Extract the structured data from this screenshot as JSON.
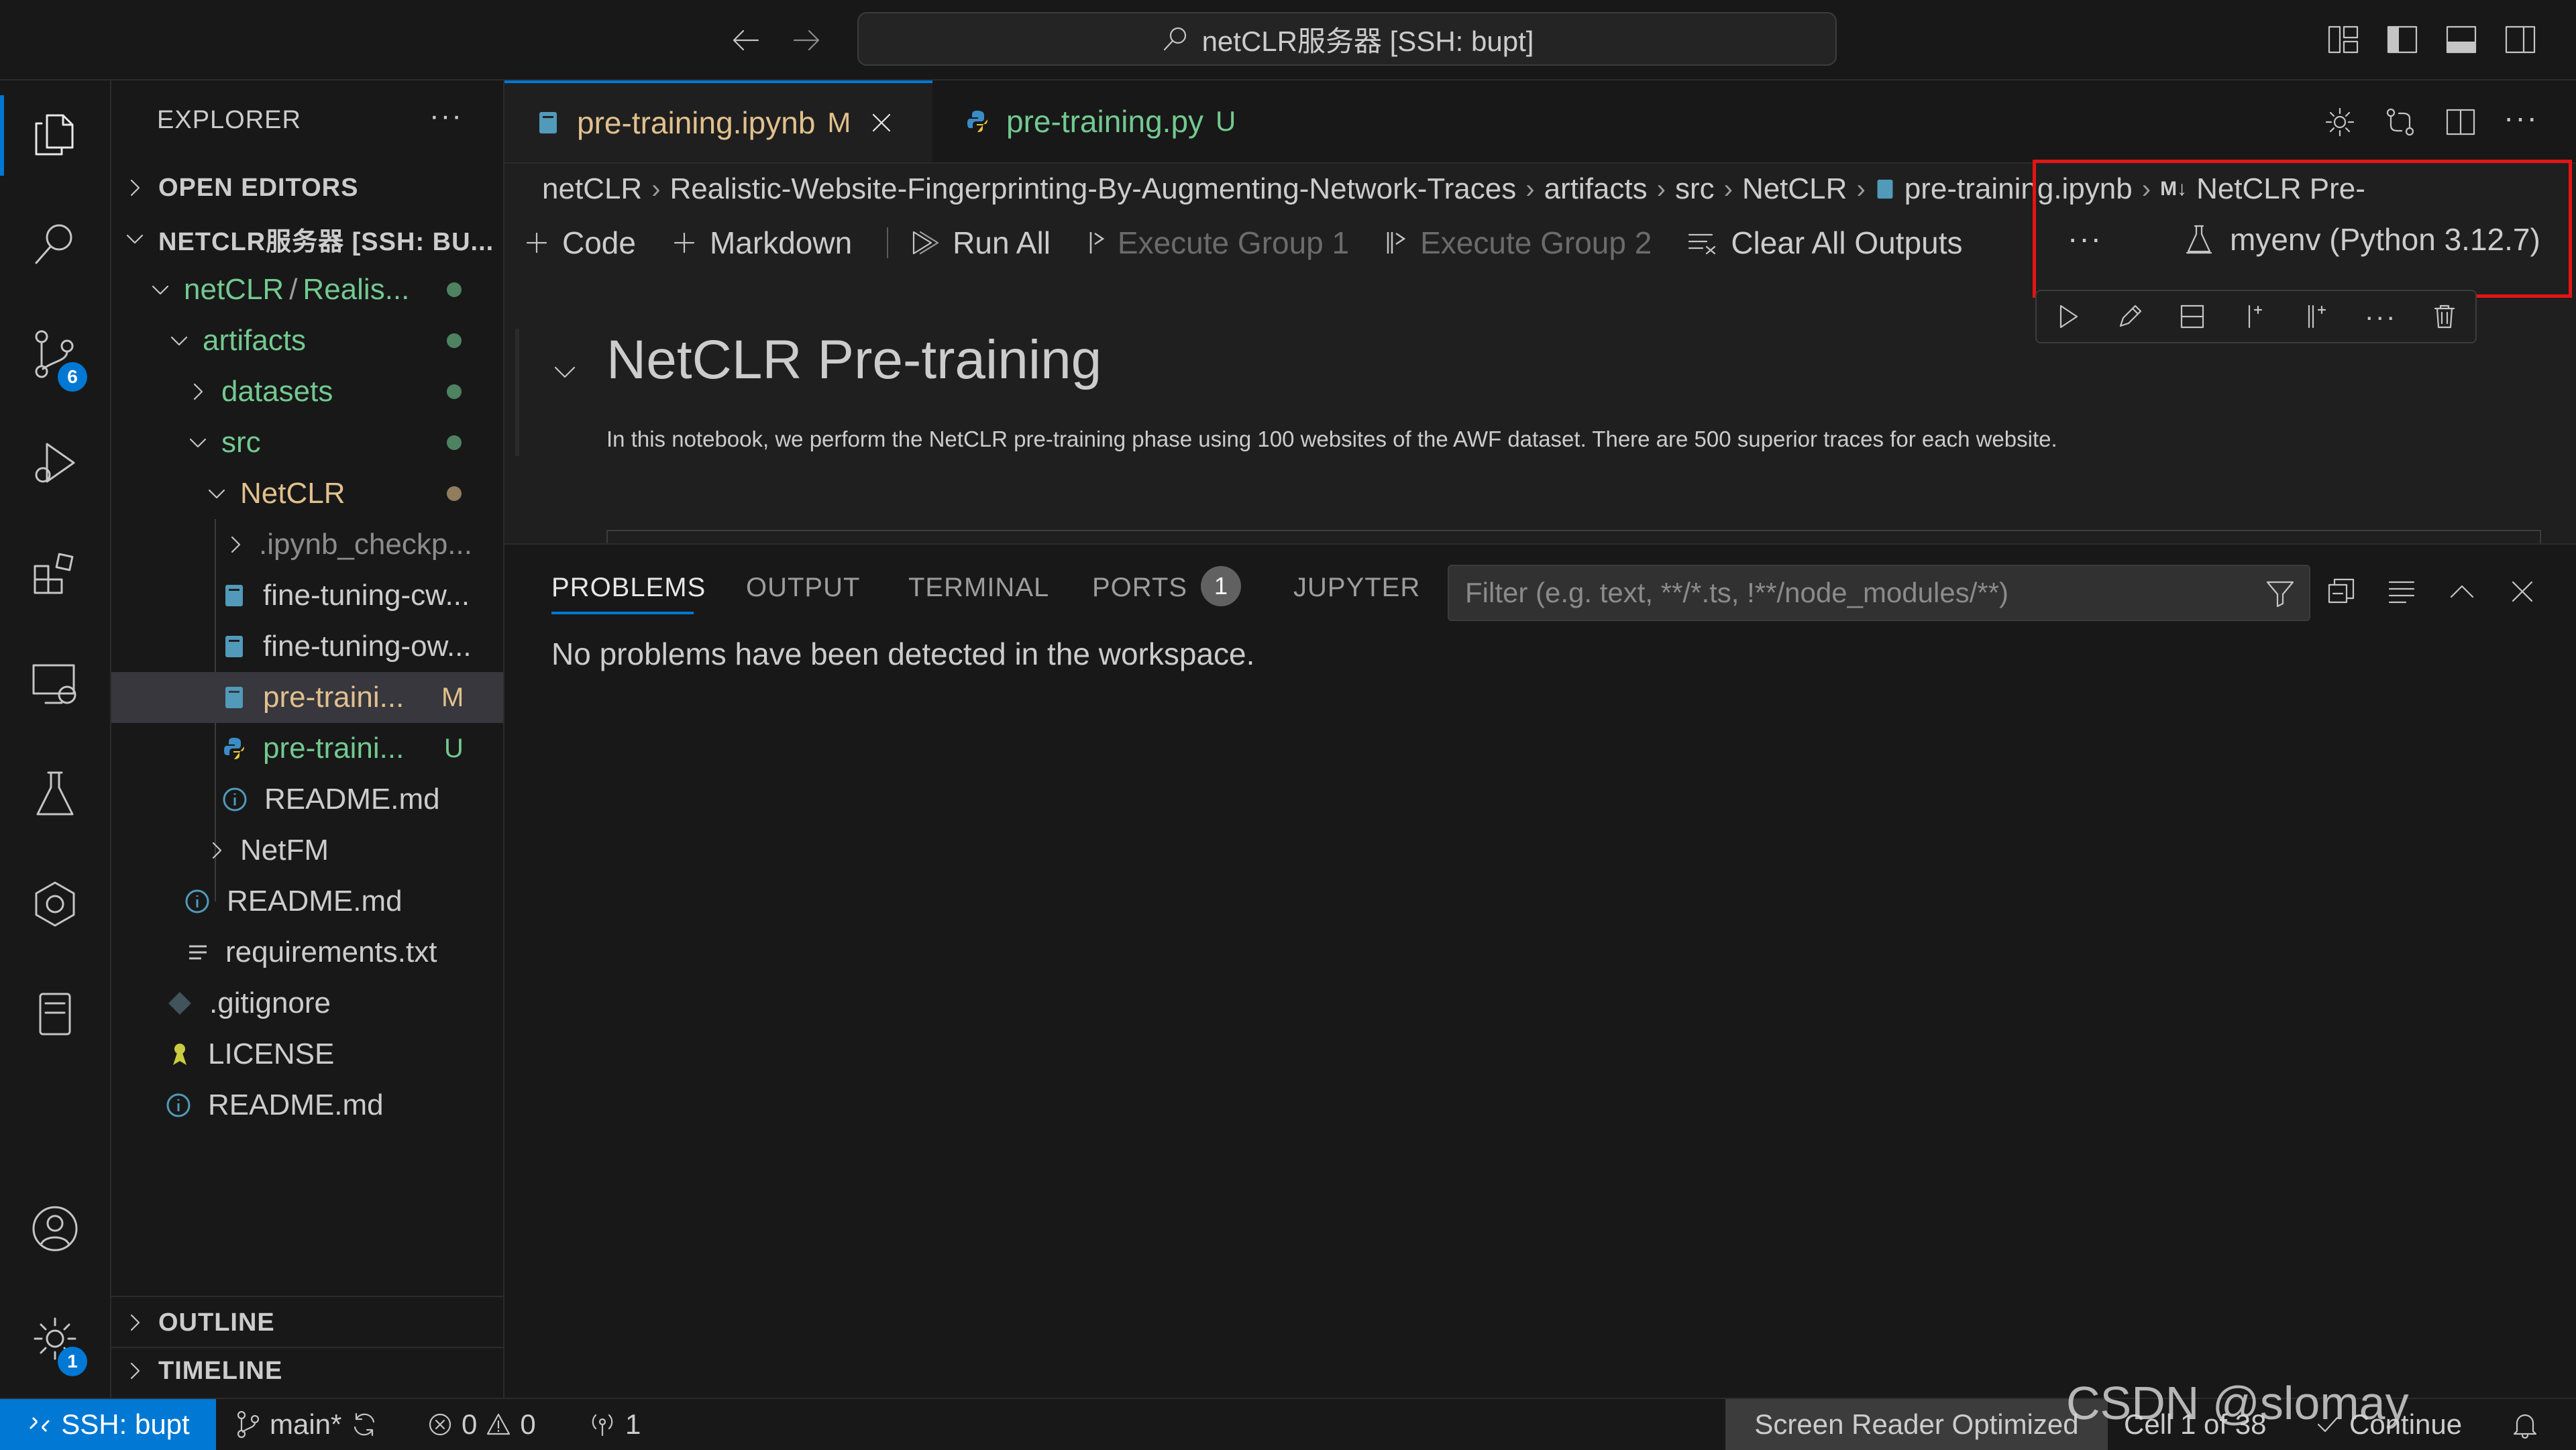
{
  "titlebar": {
    "search_text": "netCLR服务器 [SSH: bupt]"
  },
  "activity": {
    "source_control_badge": "6",
    "settings_badge": "1"
  },
  "sidebar": {
    "title": "EXPLORER",
    "open_editors": "OPEN EDITORS",
    "workspace": "NETCLR服务器 [SSH: BU...",
    "root_folder_a": "netCLR",
    "root_folder_sep": "/",
    "root_folder_b": "Realis...",
    "items": [
      {
        "label": "artifacts"
      },
      {
        "label": "datasets"
      },
      {
        "label": "src"
      },
      {
        "label": "NetCLR"
      },
      {
        "label": ".ipynb_checkp..."
      },
      {
        "label": "fine-tuning-cw..."
      },
      {
        "label": "fine-tuning-ow..."
      },
      {
        "label": "pre-traini...",
        "status": "M"
      },
      {
        "label": "pre-traini...",
        "status": "U"
      },
      {
        "label": "README.md"
      },
      {
        "label": "NetFM"
      },
      {
        "label": "README.md"
      },
      {
        "label": "requirements.txt"
      },
      {
        "label": ".gitignore"
      },
      {
        "label": "LICENSE"
      },
      {
        "label": "README.md"
      }
    ],
    "outline": "OUTLINE",
    "timeline": "TIMELINE"
  },
  "tabs": [
    {
      "label": "pre-training.ipynb",
      "status": "M"
    },
    {
      "label": "pre-training.py",
      "status": "U"
    }
  ],
  "breadcrumbs": [
    "netCLR",
    "Realistic-Website-Fingerprinting-By-Augmenting-Network-Traces",
    "artifacts",
    "src",
    "NetCLR",
    "pre-training.ipynb",
    "NetCLR Pre-"
  ],
  "breadcrumb_md_icon": "M↓",
  "toolbar": {
    "code": "Code",
    "markdown": "Markdown",
    "run_all": "Run All",
    "exec_group1": "Execute Group 1",
    "exec_group2": "Execute Group 2",
    "clear_outputs": "Clear All Outputs",
    "more": "···",
    "kernel": "myenv (Python 3.12.7)"
  },
  "cell": {
    "title": "NetCLR Pre-training",
    "description": "In this notebook, we perform the NetCLR pre-training phase using 100 websites of the AWF dataset. There are 500 superior traces for each website."
  },
  "panel": {
    "tabs": [
      "PROBLEMS",
      "OUTPUT",
      "TERMINAL",
      "PORTS",
      "JUPYTER"
    ],
    "ports_badge": "1",
    "filter_placeholder": "Filter (e.g. text, **/*.ts, !**/node_modules/**)",
    "message": "No problems have been detected in the workspace."
  },
  "statusbar": {
    "remote": "SSH: bupt",
    "branch": "main*",
    "errors": "0",
    "warnings": "0",
    "ports": "1",
    "screen_reader": "Screen Reader Optimized",
    "cell": "Cell 1 of 38",
    "continue": "Continue",
    "watermark": "CSDN @slomay"
  },
  "colors": {
    "accent": "#0078d4",
    "modified": "#e2c08d",
    "untracked": "#73c991",
    "highlight_box": "#e51414",
    "remote_bg": "#0078d4"
  }
}
